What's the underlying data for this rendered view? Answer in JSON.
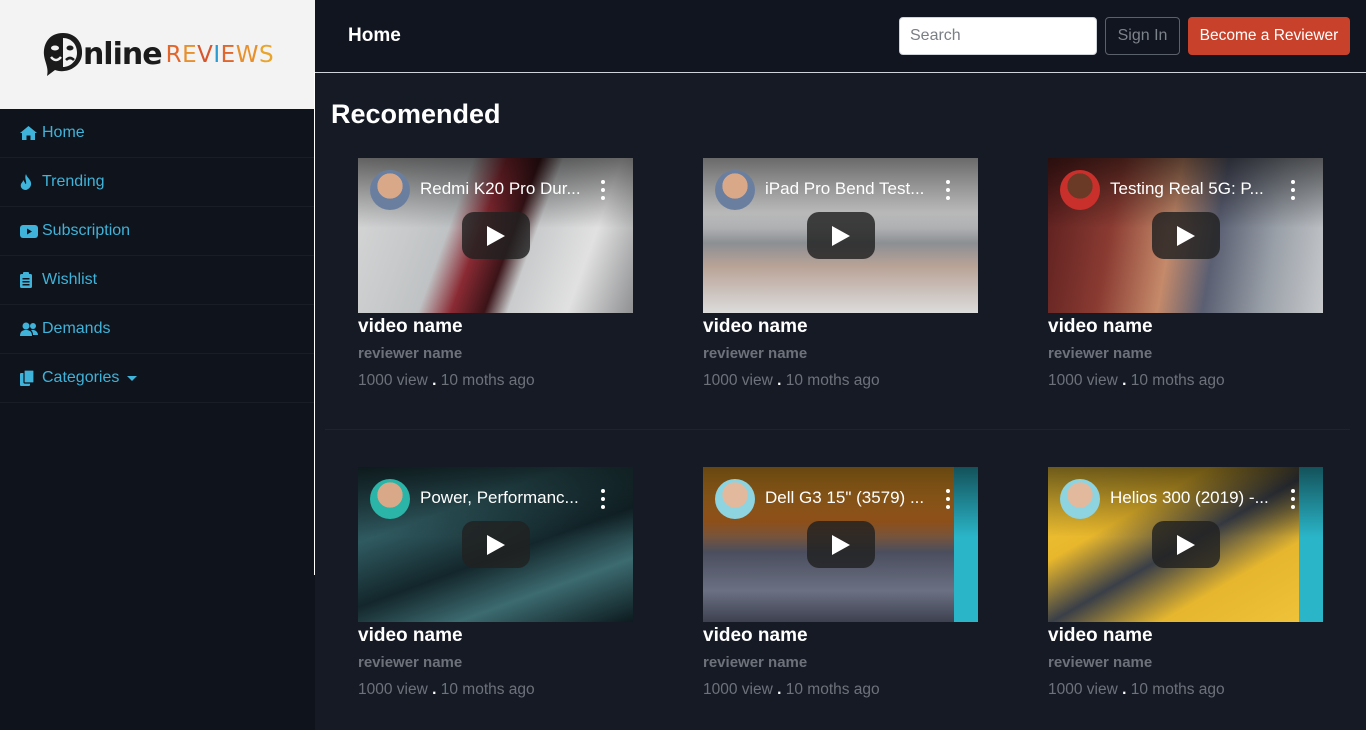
{
  "brand": {
    "logo_main": "nline",
    "logo_sub": [
      "R",
      "E",
      "V",
      "I",
      "E",
      "W",
      "S"
    ],
    "logo_sub_colors": [
      "#e2662b",
      "#e8902c",
      "#d9562d",
      "#2a9bd0",
      "#e2662b",
      "#e8902c",
      "#e8a42d"
    ]
  },
  "sidebar": {
    "items": [
      {
        "label": "Home",
        "icon": "home-icon"
      },
      {
        "label": "Trending",
        "icon": "fire-icon"
      },
      {
        "label": "Subscription",
        "icon": "youtube-icon"
      },
      {
        "label": "Wishlist",
        "icon": "clipboard-icon"
      },
      {
        "label": "Demands",
        "icon": "users-icon"
      },
      {
        "label": "Categories",
        "icon": "copy-icon"
      }
    ]
  },
  "header": {
    "title": "Home",
    "search_placeholder": "Search",
    "signin_label": "Sign In",
    "reviewer_label": "Become a Reviewer"
  },
  "main": {
    "section_title": "Recomended",
    "videos": [
      {
        "thumb_title": "Redmi K20 Pro Dur...",
        "name": "video name",
        "reviewer": "reviewer name",
        "views": "1000 view",
        "dot": ".",
        "age": "10 moths ago"
      },
      {
        "thumb_title": "iPad Pro Bend Test...",
        "name": "video name",
        "reviewer": "reviewer name",
        "views": "1000 view",
        "dot": ".",
        "age": "10 moths ago"
      },
      {
        "thumb_title": "Testing Real 5G: P...",
        "name": "video name",
        "reviewer": "reviewer name",
        "views": "1000 view",
        "dot": ".",
        "age": "10 moths ago"
      },
      {
        "thumb_title": "Power, Performanc...",
        "name": "video name",
        "reviewer": "reviewer name",
        "views": "1000 view",
        "dot": ".",
        "age": "10 moths ago"
      },
      {
        "thumb_title": "Dell G3 15\" (3579) ...",
        "name": "video name",
        "reviewer": "reviewer name",
        "views": "1000 view",
        "dot": ".",
        "age": "10 moths ago"
      },
      {
        "thumb_title": "Helios 300 (2019) -...",
        "name": "video name",
        "reviewer": "reviewer name",
        "views": "1000 view",
        "dot": ".",
        "age": "10 moths ago"
      }
    ]
  }
}
